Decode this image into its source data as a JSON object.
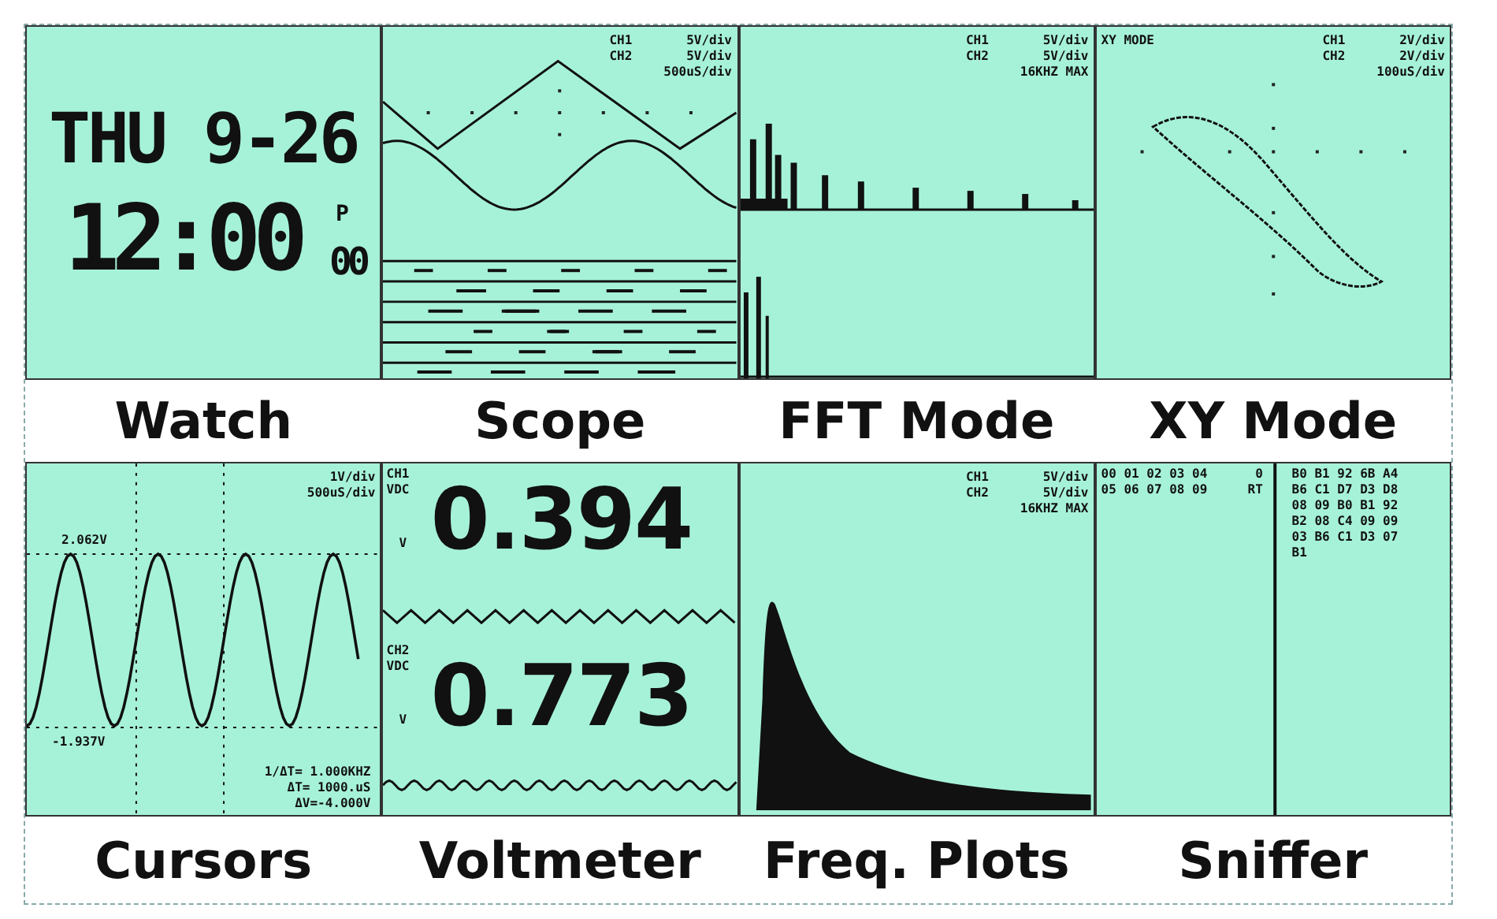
{
  "panels": [
    {
      "kind": "watch",
      "label": "Watch",
      "date": "THU 9-26",
      "time": "12:00",
      "meridiem": "P",
      "seconds": "00"
    },
    {
      "kind": "scope",
      "label": "Scope",
      "readouts": [
        {
          "left": "CH1",
          "right": "5V/div"
        },
        {
          "left": "CH2",
          "right": "5V/div"
        },
        {
          "right": "500uS/div"
        }
      ]
    },
    {
      "kind": "fft",
      "label": "FFT Mode",
      "readouts": [
        {
          "left": "CH1",
          "right": "5V/div"
        },
        {
          "left": "CH2",
          "right": "5V/div"
        },
        {
          "right": "16KHZ MAX"
        }
      ]
    },
    {
      "kind": "xy",
      "label": "XY Mode",
      "title": "XY MODE",
      "readouts": [
        {
          "left": "CH1",
          "right": "2V/div"
        },
        {
          "left": "CH2",
          "right": "2V/div"
        },
        {
          "right": "100uS/div"
        }
      ]
    },
    {
      "kind": "cursors",
      "label": "Cursors",
      "readouts": [
        {
          "right": "1V/div"
        },
        {
          "right": "500uS/div"
        }
      ],
      "upper": "2.062V",
      "lower": "-1.937V",
      "measurements": [
        "1/ΔT= 1.000KHZ",
        "ΔT= 1000.uS",
        "ΔV=-4.000V"
      ]
    },
    {
      "kind": "voltmeter",
      "label": "Voltmeter",
      "channels": [
        {
          "name": "CH1",
          "mode": "VDC",
          "unit": "V",
          "value": "0.394"
        },
        {
          "name": "CH2",
          "mode": "VDC",
          "unit": "V",
          "value": "0.773"
        }
      ]
    },
    {
      "kind": "freq",
      "label": "Freq. Plots",
      "readouts": [
        {
          "left": "CH1",
          "right": "5V/div"
        },
        {
          "left": "CH2",
          "right": "5V/div"
        },
        {
          "right": "16KHZ MAX"
        }
      ]
    },
    {
      "kind": "sniffer",
      "label": "Sniffer",
      "left_lines": [
        "00 01 02 03 04",
        "05 06 07 08 09"
      ],
      "middle_lines": [
        "0",
        "RT"
      ],
      "right_lines": [
        "B0 B1 92 6B A4",
        "B6 C1 D7 D3 D8",
        "08 09 B0 B1 92",
        "B2 08 C4 09 09",
        "03 B6 C1 D3 07",
        "B1"
      ]
    }
  ]
}
